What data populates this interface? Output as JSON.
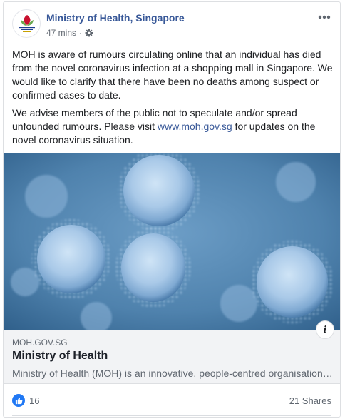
{
  "post": {
    "page_name": "Ministry of Health, Singapore",
    "timestamp": "47 mins",
    "separator": "·",
    "privacy_icon": "gear-icon",
    "more_icon": "more-options-icon",
    "avatar_logo_text": "MINISTRY OF HEALTH",
    "text_p1": "MOH is aware of rumours circulating online that an individual has died from the novel coronavirus infection at a shopping mall in Singapore. We would like to clarify that there have been no deaths among suspect or confirmed cases to date.",
    "text_p2_before": "We advise members of the public not to speculate and/or spread unfounded rumours. Please visit ",
    "text_p2_link": "www.moh.gov.sg",
    "text_p2_after": " for updates on the novel coronavirus situation."
  },
  "link_preview": {
    "domain": "MOH.GOV.SG",
    "title": "Ministry of Health",
    "description": "Ministry of Health (MOH) is an innovative, people-centred organisation committed to medical excellence, the promotion of good health, the reduction of illness and access to good and affordable healthcare for all Singaporeans.",
    "info_label": "i"
  },
  "footer": {
    "reaction_icon": "like-icon",
    "reaction_count": "16",
    "shares": "21 Shares"
  },
  "colors": {
    "link_blue": "#385898",
    "like_blue": "#2078f4",
    "image_blue": "#5d8fb8"
  }
}
